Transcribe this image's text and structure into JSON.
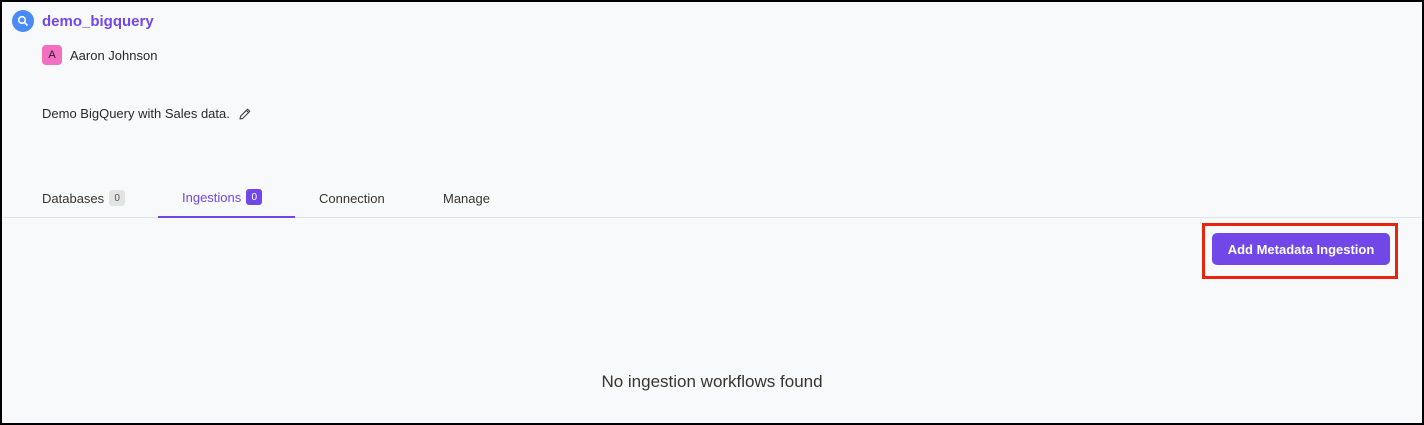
{
  "service": {
    "name": "demo_bigquery",
    "icon": "bigquery-icon"
  },
  "owner": {
    "avatar_letter": "A",
    "name": "Aaron Johnson"
  },
  "description": "Demo BigQuery with Sales data.",
  "tabs": [
    {
      "label": "Databases",
      "count": "0",
      "active": false
    },
    {
      "label": "Ingestions",
      "count": "0",
      "active": true
    },
    {
      "label": "Connection",
      "active": false
    },
    {
      "label": "Manage",
      "active": false
    }
  ],
  "actions": {
    "add_ingestion_label": "Add Metadata Ingestion"
  },
  "empty_state": "No ingestion workflows found",
  "colors": {
    "accent": "#7147e8",
    "highlight": "#e8240c",
    "avatar": "#f26fc2"
  }
}
